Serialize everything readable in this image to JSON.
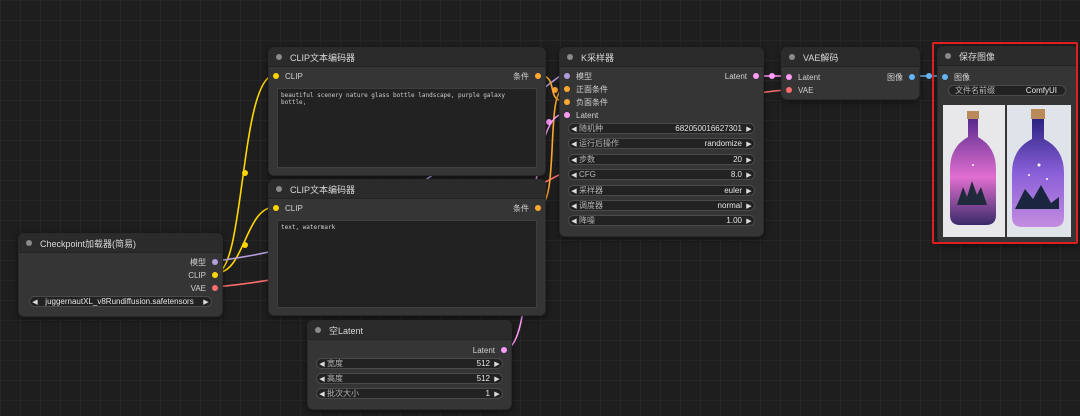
{
  "colors": {
    "clip": "#ffd500",
    "model": "#b39ddb",
    "vae": "#ff6e6e",
    "latent": "#ff9cf9",
    "cond": "#ffa931",
    "image": "#64b5f6"
  },
  "checkpoint": {
    "title": "Checkpoint加载器(简易)",
    "out_model": "模型",
    "out_clip": "CLIP",
    "out_vae": "VAE",
    "ckpt_value": "juggernautXL_v8Rundiffusion.safetensors"
  },
  "clip1": {
    "title": "CLIP文本编码器",
    "in_clip": "CLIP",
    "out_cond": "条件",
    "text": "beautiful scenery nature glass bottle landscape, purple galaxy bottle,"
  },
  "clip2": {
    "title": "CLIP文本编码器",
    "in_clip": "CLIP",
    "out_cond": "条件",
    "text": "text, watermark"
  },
  "latent": {
    "title": "空Latent",
    "out_latent": "Latent",
    "widgets": [
      {
        "label": "宽度",
        "value": "512"
      },
      {
        "label": "高度",
        "value": "512"
      },
      {
        "label": "批次大小",
        "value": "1"
      }
    ]
  },
  "ksampler": {
    "title": "K采样器",
    "in_model": "模型",
    "in_pos": "正面条件",
    "in_neg": "负面条件",
    "in_latent": "Latent",
    "out_latent": "Latent",
    "widgets": [
      {
        "label": "随机种",
        "value": "682050016627301"
      },
      {
        "label": "运行后操作",
        "value": "randomize"
      },
      {
        "label": "步数",
        "value": "20"
      },
      {
        "label": "CFG",
        "value": "8.0"
      },
      {
        "label": "采样器",
        "value": "euler"
      },
      {
        "label": "调度器",
        "value": "normal"
      },
      {
        "label": "降噪",
        "value": "1.00"
      }
    ]
  },
  "vae": {
    "title": "VAE解码",
    "in_latent": "Latent",
    "in_vae": "VAE",
    "out_image": "图像"
  },
  "save": {
    "title": "保存图像",
    "in_image": "图像",
    "prefix_label": "文件名前缀",
    "prefix_value": "ComfyUI"
  },
  "icons": {
    "left": "◀",
    "right": "▶",
    "title_dot": "node-status-dot-icon"
  }
}
